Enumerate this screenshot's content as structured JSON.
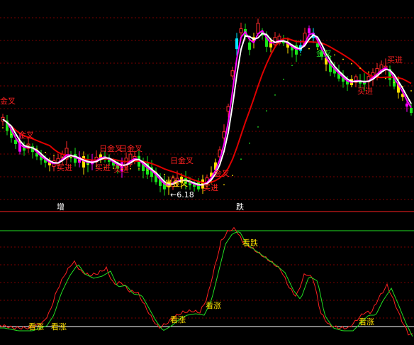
{
  "colors": {
    "background": "#000000",
    "grid": "#7a0000",
    "up_candle": "#ff2a2a",
    "down_candle": "#19e619",
    "cyan_candle": "#00e5ff",
    "yellow_candle": "#ffe000",
    "magenta_candle": "#ff00ff",
    "ma_short": "#ffffff",
    "ma_mid": "#ff00ff",
    "ma_long": "#e00000",
    "dots": "#ffe000",
    "signal_text_red": "#ff2020",
    "signal_text_yellow": "#ffe000",
    "osc_red": "#ff2020",
    "osc_green": "#22e022",
    "osc_baseline": "#ffffff",
    "osc_upper_line": "#22e022",
    "separator": "#ff2020"
  },
  "main_panel": {
    "labels": [
      {
        "text": "金叉",
        "color": "red"
      },
      {
        "text": "金叉",
        "color": "red"
      },
      {
        "text": "买进",
        "color": "red"
      },
      {
        "text": "日金叉",
        "color": "red"
      },
      {
        "text": "日金叉",
        "color": "red"
      },
      {
        "text": "买进",
        "color": "red"
      },
      {
        "text": "买进",
        "color": "red"
      },
      {
        "text": "日金叉",
        "color": "red"
      },
      {
        "text": "日金叉",
        "color": "red"
      },
      {
        "text": "←6.18",
        "color": "white"
      },
      {
        "text": "金叉",
        "color": "red"
      },
      {
        "text": "买进",
        "color": "red"
      },
      {
        "text": "买进",
        "color": "red"
      },
      {
        "text": "买进",
        "color": "red"
      }
    ]
  },
  "mid_strip": {
    "left_label": "增",
    "right_label": "跌"
  },
  "oscillator": {
    "labels": [
      {
        "text": "看涨"
      },
      {
        "text": "看涨"
      },
      {
        "text": "看涨"
      },
      {
        "text": "看涨"
      },
      {
        "text": "看跌"
      },
      {
        "text": "看涨"
      }
    ]
  }
}
